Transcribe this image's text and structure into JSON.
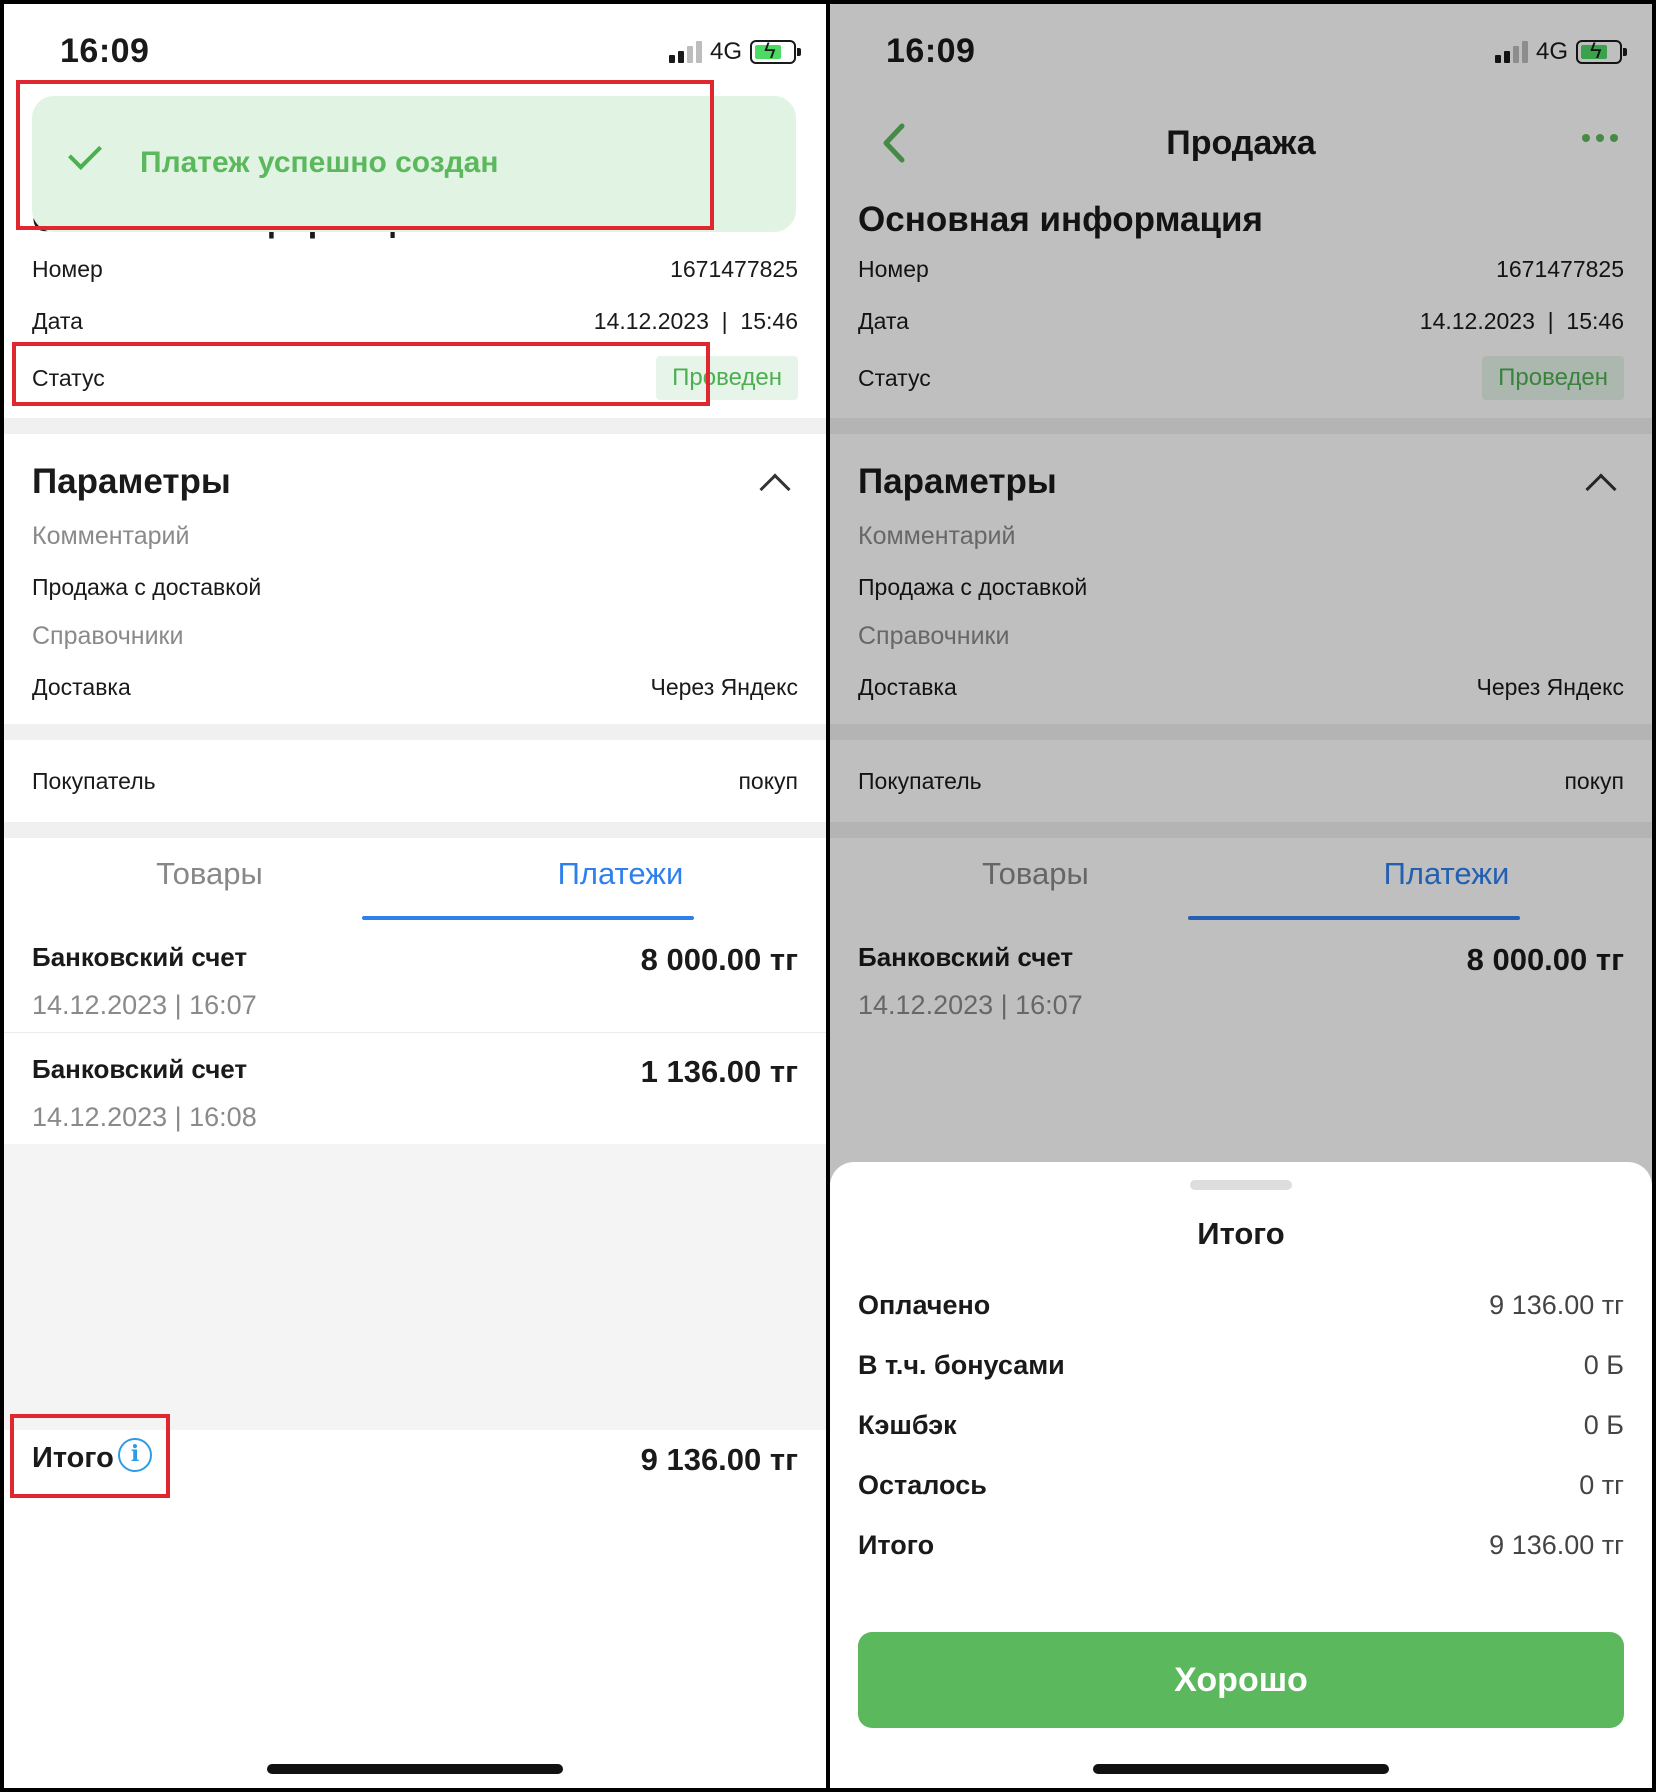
{
  "status_bar": {
    "time": "16:09",
    "network": "4G"
  },
  "toast": {
    "text": "Платеж успешно создан"
  },
  "nav": {
    "title": "Продажа"
  },
  "main_info": {
    "title": "Основная информация",
    "number_label": "Номер",
    "number_value": "1671477825",
    "date_label": "Дата",
    "date_value": "14.12.2023  |  15:46",
    "status_label": "Статус",
    "status_value": "Проведен"
  },
  "params": {
    "title": "Параметры",
    "comment_label": "Комментарий",
    "comment_value": "Продажа с доставкой",
    "refs_label": "Справочники",
    "delivery_label": "Доставка",
    "delivery_value": "Через Яндекс"
  },
  "buyer": {
    "label": "Покупатель",
    "value": "покуп"
  },
  "tabs": {
    "goods": "Товары",
    "payments": "Платежи",
    "active": "payments"
  },
  "payments": [
    {
      "title": "Банковский счет",
      "amount": "8 000.00 тг",
      "date": "14.12.2023 | 16:07"
    },
    {
      "title": "Банковский счет",
      "amount": "1 136.00 тг",
      "date": "14.12.2023 | 16:08"
    }
  ],
  "total_bar": {
    "label": "Итого",
    "info_glyph": "i",
    "value": "9 136.00 тг"
  },
  "sheet": {
    "title": "Итого",
    "rows": [
      {
        "label": "Оплачено",
        "value": "9 136.00 тг"
      },
      {
        "label": "В т.ч. бонусами",
        "value": "0 Б"
      },
      {
        "label": "Кэшбэк",
        "value": "0 Б"
      },
      {
        "label": "Осталось",
        "value": "0 тг"
      },
      {
        "label": "Итого",
        "value": "9 136.00 тг"
      }
    ],
    "ok_label": "Хорошо"
  },
  "colors": {
    "accent_green": "#5cb85c",
    "tab_blue": "#2f80ed",
    "highlight_red": "#e0262e"
  }
}
